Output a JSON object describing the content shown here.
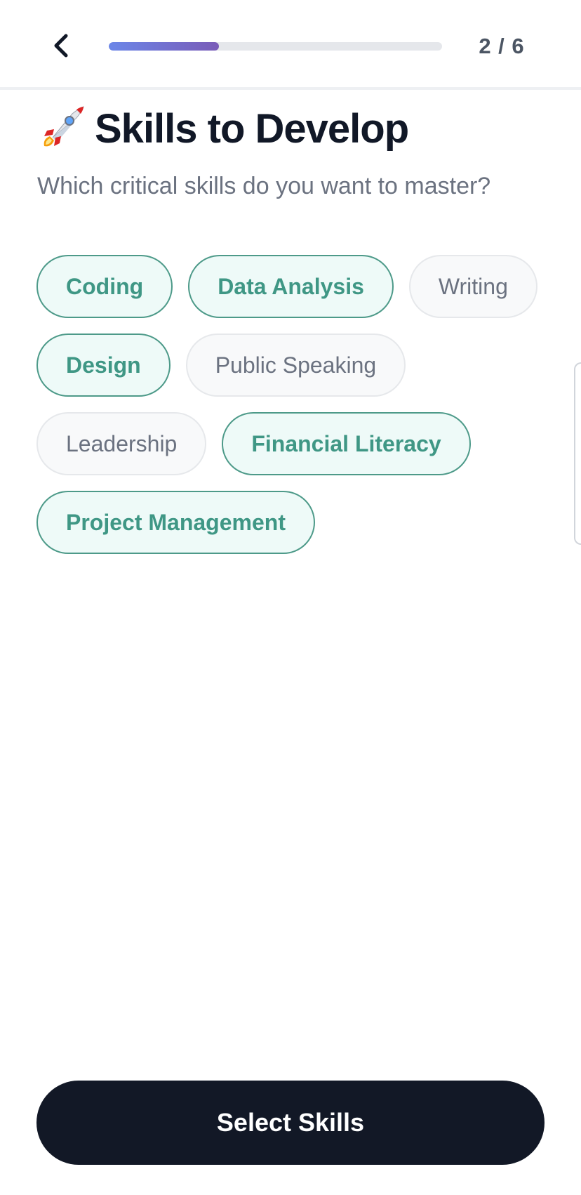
{
  "header": {
    "back_icon": "chevron-left-icon",
    "progress": 0.33,
    "step_counter": "2 / 6",
    "progress_colors": [
      "#6b86e8",
      "#7a5cb8"
    ]
  },
  "page": {
    "title_icon": "rocket-icon",
    "title": "Skills to Develop",
    "subtitle": "Which critical skills do you want to master?"
  },
  "skills": [
    {
      "label": "Coding",
      "selected": true
    },
    {
      "label": "Data Analysis",
      "selected": true
    },
    {
      "label": "Writing",
      "selected": false
    },
    {
      "label": "Design",
      "selected": true
    },
    {
      "label": "Public Speaking",
      "selected": false
    },
    {
      "label": "Leadership",
      "selected": false
    },
    {
      "label": "Financial Literacy",
      "selected": true
    },
    {
      "label": "Project Management",
      "selected": true
    }
  ],
  "colors": {
    "selected_border": "#4d9a89",
    "selected_text": "#3f9785",
    "selected_bg": "#eefaf8",
    "button_bg": "#121826"
  },
  "footer": {
    "primary_button_label": "Select Skills"
  }
}
